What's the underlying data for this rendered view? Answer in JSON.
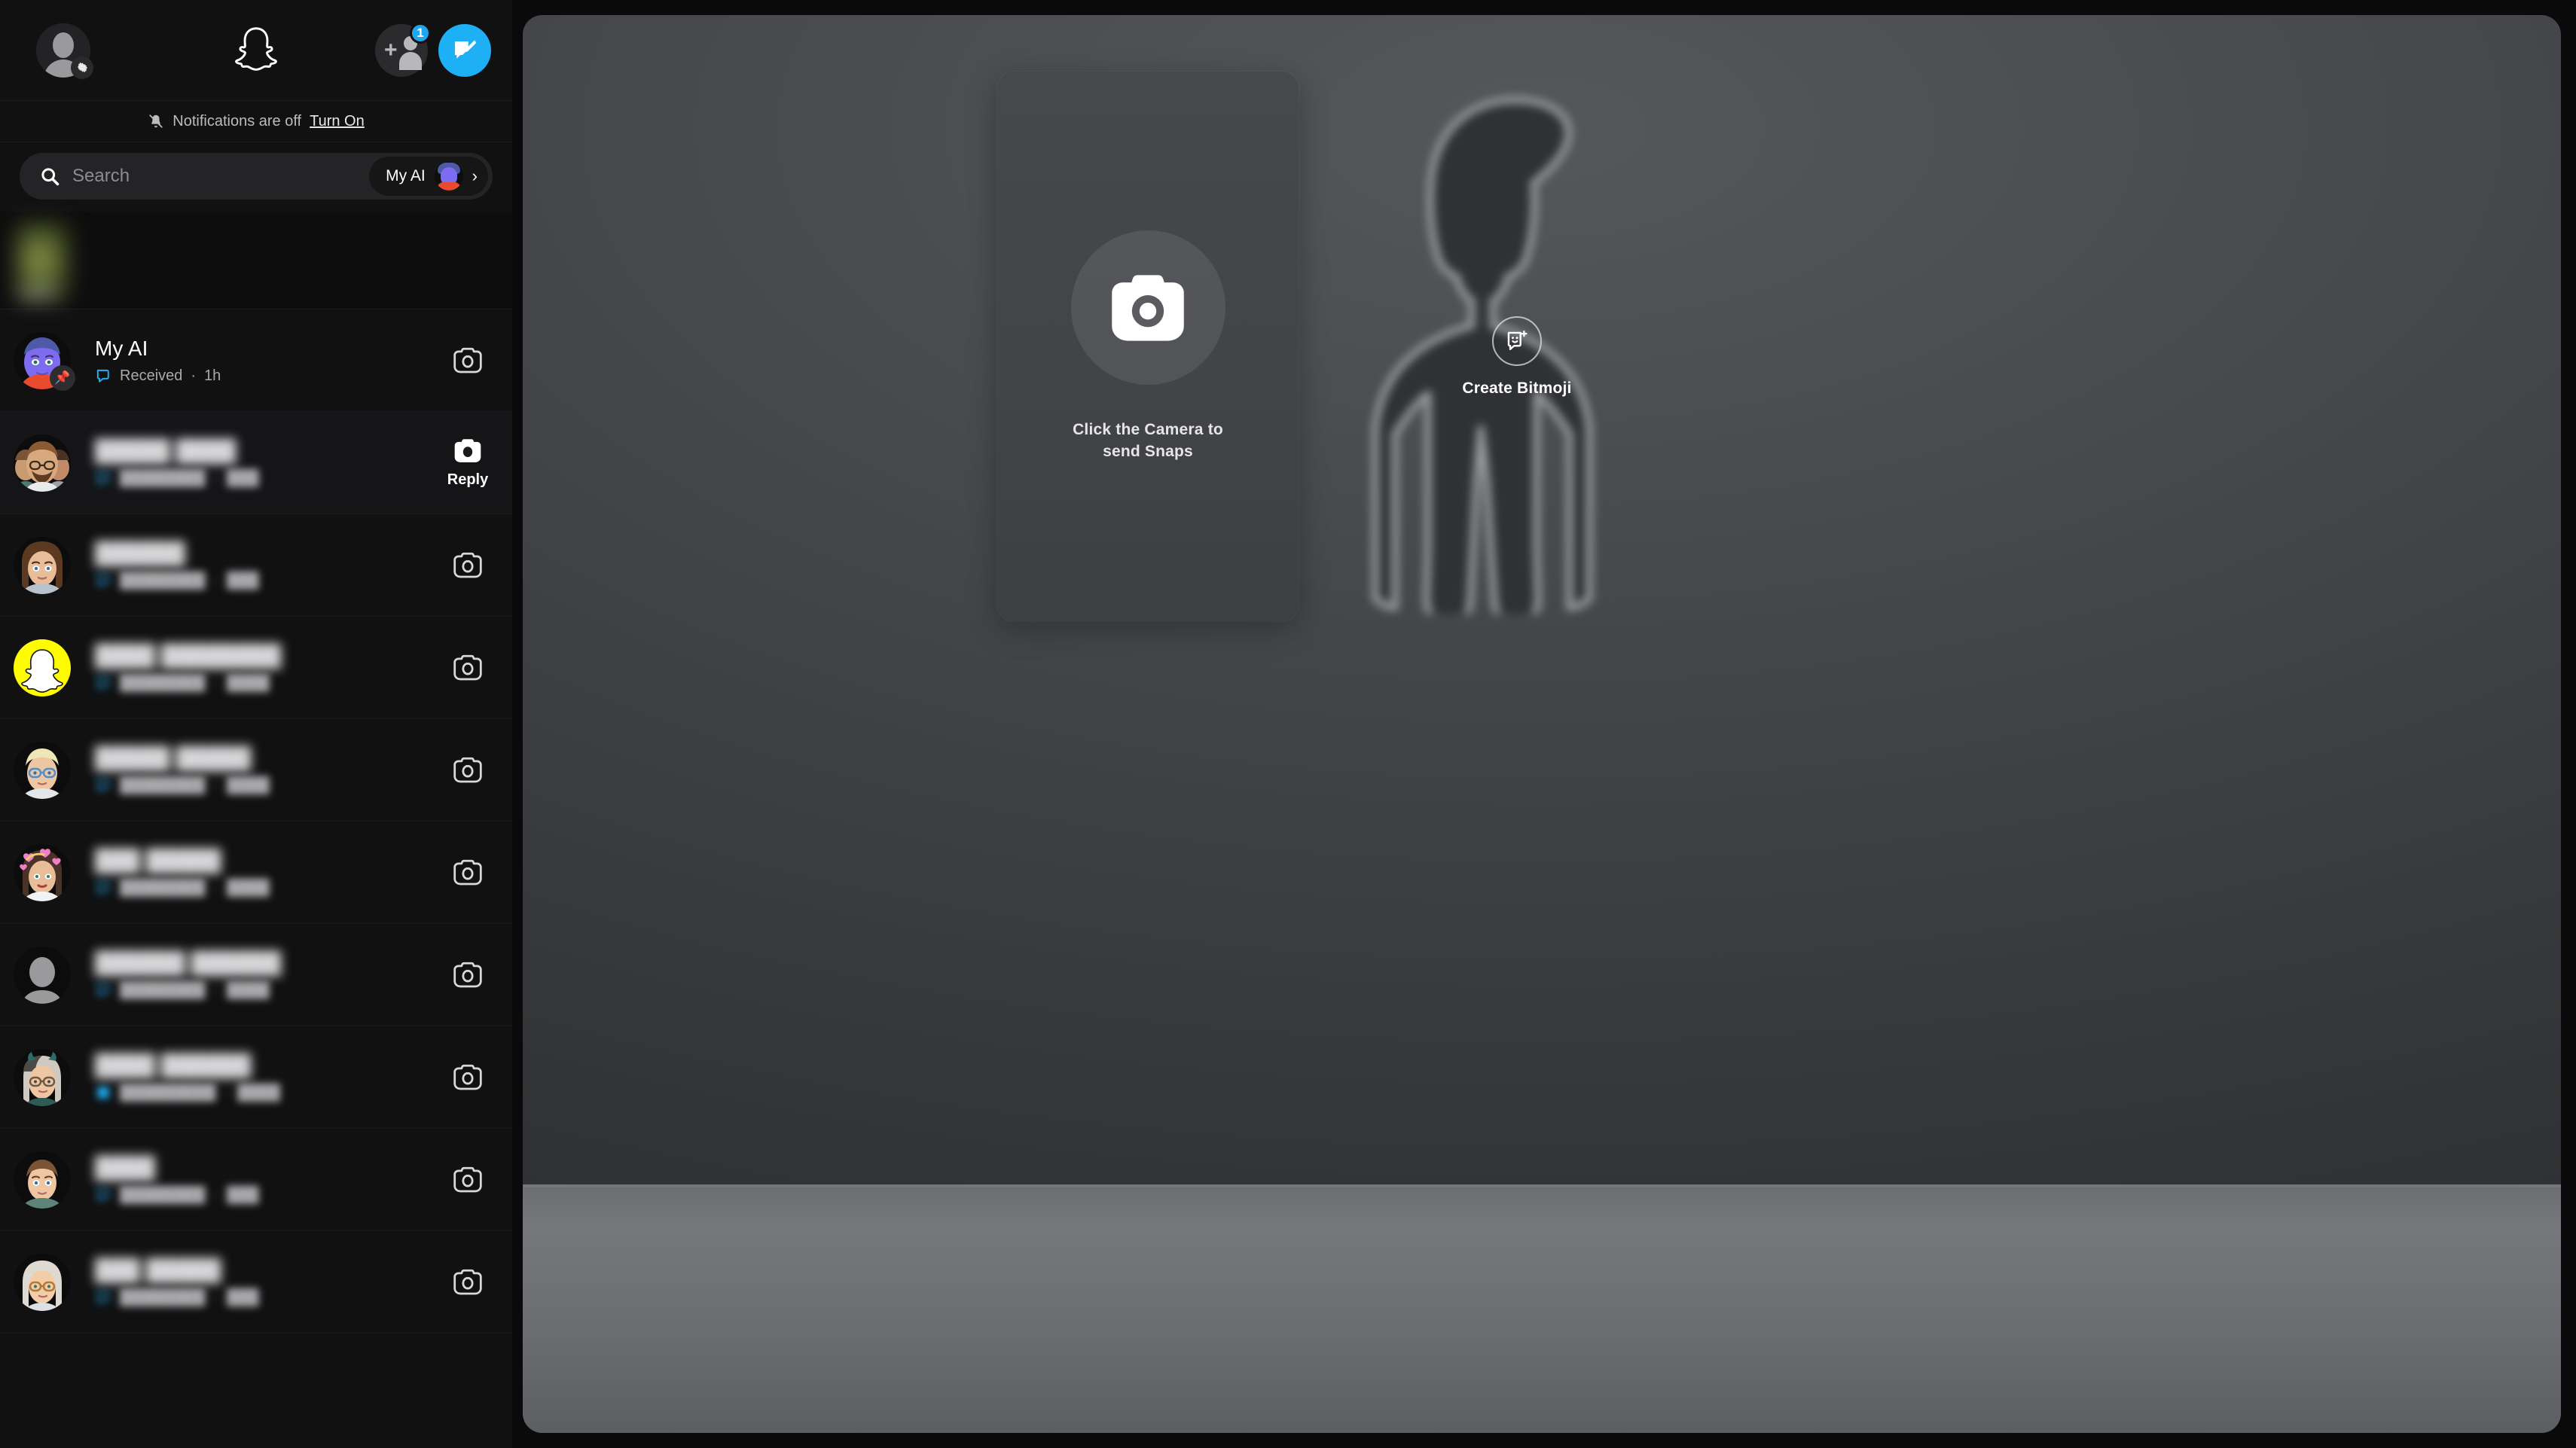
{
  "app": {
    "name": "Snapchat for Web"
  },
  "sidebar": {
    "topbar": {
      "profile_icon": "profile-settings-icon",
      "logo_icon": "snapchat-ghost-logo",
      "add_friend_icon": "add-friend-icon",
      "add_friend_badge": "1",
      "new_chat_icon": "new-chat-icon"
    },
    "notifications": {
      "bell_icon": "bell-off-icon",
      "message": "Notifications are off",
      "action_label": "Turn On"
    },
    "search": {
      "icon": "search-icon",
      "placeholder": "Search",
      "myai_label": "My AI",
      "myai_avatar": "my-ai-bitmoji-avatar",
      "chevron": "chevron-right-icon"
    },
    "story_strip": {
      "tile_label": "",
      "state": "blurred"
    },
    "chats": [
      {
        "name": "My AI",
        "name_blurred": false,
        "avatar": "my-ai-bitmoji-avatar",
        "pinned": true,
        "pin_icon": "pin-icon",
        "status_icon": "chat-received-icon",
        "status": "Received",
        "separator": "·",
        "time": "1h",
        "action_icon": "camera-icon",
        "action_label": ""
      },
      {
        "name": "█████ ████",
        "name_blurred": true,
        "avatar": "group-bitmoji-avatar",
        "pinned": false,
        "status_icon": "chat-received-icon",
        "status": "████████",
        "separator": "·",
        "time": "███",
        "action_icon": "camera-icon",
        "action_label": "Reply",
        "hovered": true
      },
      {
        "name": "██████",
        "name_blurred": true,
        "avatar": "woman-brown-hair-bitmoji",
        "pinned": false,
        "status_icon": "chat-received-icon",
        "status": "████████",
        "separator": "·",
        "time": "███",
        "action_icon": "camera-icon",
        "action_label": ""
      },
      {
        "name": "████ ████████",
        "name_blurred": true,
        "avatar": "snapchat-team-ghost-avatar",
        "pinned": false,
        "status_icon": "chat-received-icon",
        "status": "████████",
        "separator": "·",
        "time": "████",
        "action_icon": "camera-icon",
        "action_label": ""
      },
      {
        "name": "█████ █████",
        "name_blurred": true,
        "avatar": "blonde-glasses-bitmoji",
        "pinned": false,
        "status_icon": "chat-received-icon",
        "status": "████████",
        "separator": "·",
        "time": "████",
        "action_icon": "camera-icon",
        "action_label": ""
      },
      {
        "name": "███ █████",
        "name_blurred": true,
        "avatar": "hearts-crown-bitmoji",
        "pinned": false,
        "status_icon": "chat-received-icon",
        "status": "████████",
        "separator": "·",
        "time": "████",
        "action_icon": "camera-icon",
        "action_label": ""
      },
      {
        "name": "██████ ██████",
        "name_blurred": true,
        "avatar": "default-person-avatar",
        "pinned": false,
        "status_icon": "chat-received-icon",
        "status": "████████",
        "separator": "·",
        "time": "████",
        "action_icon": "camera-icon",
        "action_label": ""
      },
      {
        "name": "████ ██████",
        "name_blurred": true,
        "avatar": "horns-glasses-bitmoji",
        "pinned": false,
        "status_icon": "chat-delivered-icon",
        "status": "█████████",
        "separator": "·",
        "time": "████",
        "action_icon": "camera-icon",
        "action_label": ""
      },
      {
        "name": "████",
        "name_blurred": true,
        "avatar": "short-hair-teen-bitmoji",
        "pinned": false,
        "status_icon": "chat-received-icon",
        "status": "████████",
        "separator": "·",
        "time": "███",
        "action_icon": "camera-icon",
        "action_label": ""
      },
      {
        "name": "███ █████",
        "name_blurred": true,
        "avatar": "white-hair-glasses-bitmoji",
        "pinned": false,
        "status_icon": "chat-received-icon",
        "status": "████████",
        "separator": "·",
        "time": "███",
        "action_icon": "camera-icon",
        "action_label": ""
      }
    ]
  },
  "main": {
    "camera_card": {
      "icon": "camera-icon",
      "caption_line1": "Click the Camera to",
      "caption_line2": "send Snaps"
    },
    "bitmoji": {
      "silhouette": "bitmoji-placeholder-silhouette",
      "icon": "create-bitmoji-icon",
      "label": "Create Bitmoji"
    }
  },
  "colors": {
    "accent_blue": "#1eb0f5",
    "snapchat_yellow": "#fffc00",
    "sidebar_bg": "#111112",
    "main_bg": "#3f4145",
    "text_primary": "#ffffff",
    "text_secondary": "#a9a9ac"
  }
}
